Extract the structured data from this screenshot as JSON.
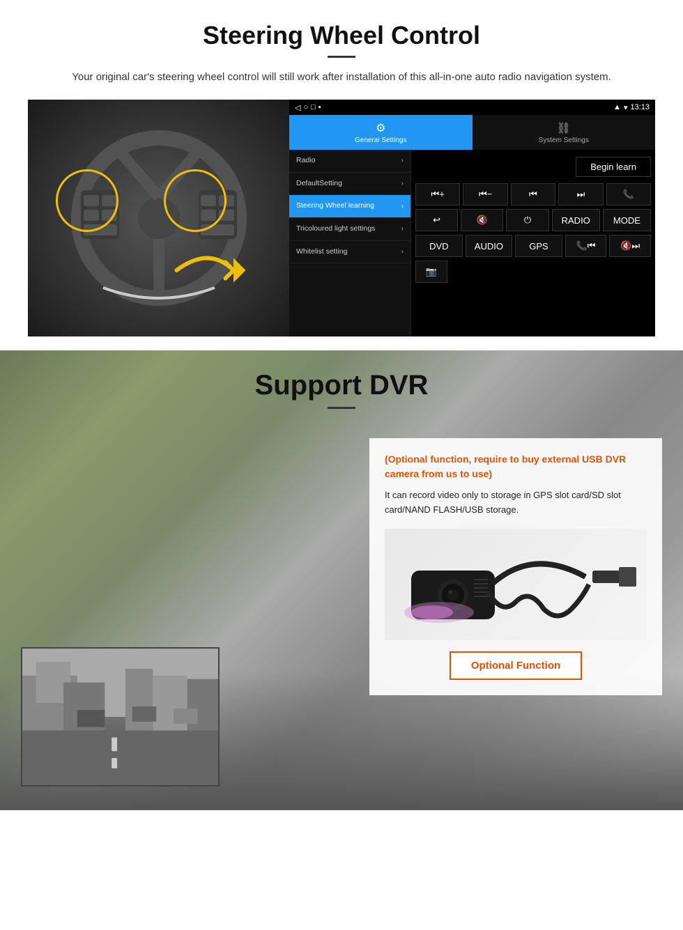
{
  "page": {
    "section1": {
      "title": "Steering Wheel Control",
      "subtitle": "Your original car's steering wheel control will still work after installation of this all-in-one auto radio navigation system.",
      "android": {
        "statusbar": {
          "time": "13:13",
          "icons": "signal wifi battery"
        },
        "tabs": [
          {
            "label": "General Settings",
            "icon": "⚙"
          },
          {
            "label": "System Settings",
            "icon": "🔗"
          }
        ],
        "menu_items": [
          {
            "label": "Radio",
            "active": false
          },
          {
            "label": "DefaultSetting",
            "active": false
          },
          {
            "label": "Steering Wheel learning",
            "active": true
          },
          {
            "label": "Tricoloured light settings",
            "active": false
          },
          {
            "label": "Whitelist setting",
            "active": false
          }
        ],
        "begin_learn": "Begin learn",
        "control_rows": [
          [
            "⏮+",
            "⏮-",
            "⏮|",
            "⏭|",
            "📞"
          ],
          [
            "↩",
            "🔇",
            "⏻",
            "RADIO",
            "MODE"
          ],
          [
            "DVD",
            "AUDIO",
            "GPS",
            "📞⏮|",
            "🔇⏭|"
          ],
          [
            "📷"
          ]
        ]
      }
    },
    "section2": {
      "title": "Support DVR",
      "optional_note": "(Optional function, require to buy external USB DVR camera from us to use)",
      "description": "It can record video only to storage in GPS slot card/SD slot card/NAND FLASH/USB storage.",
      "optional_button": "Optional Function"
    }
  }
}
